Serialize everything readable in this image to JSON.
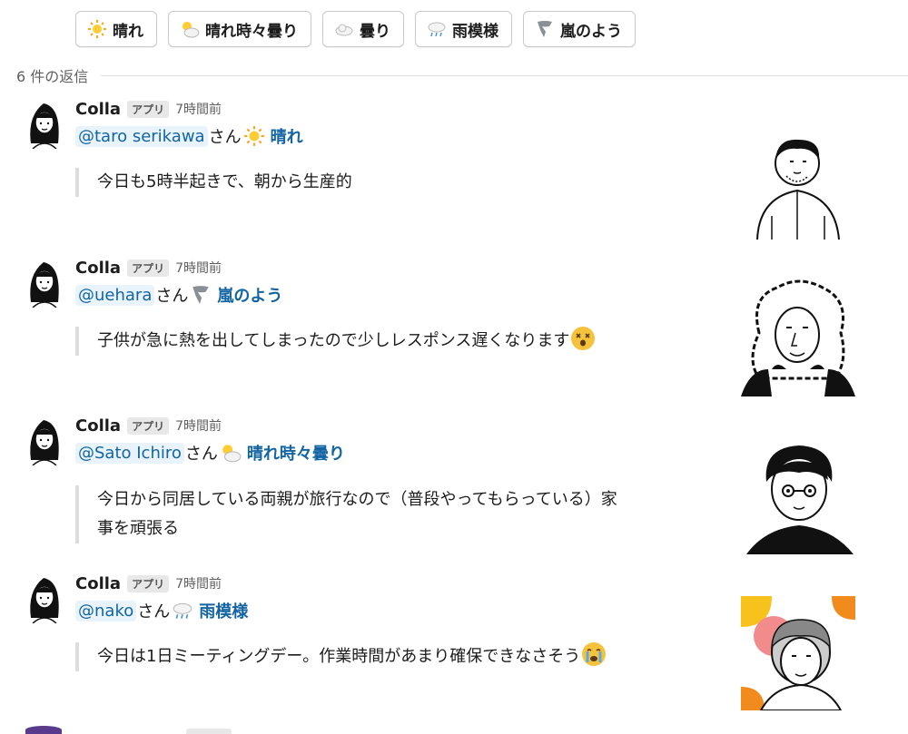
{
  "weather_buttons": [
    {
      "label": "晴れ",
      "icon": "sun-icon"
    },
    {
      "label": "晴れ時々曇り",
      "icon": "sun-behind-cloud-icon"
    },
    {
      "label": "曇り",
      "icon": "cloud-icon"
    },
    {
      "label": "雨模様",
      "icon": "rain-cloud-icon"
    },
    {
      "label": "嵐のよう",
      "icon": "tornado-icon"
    }
  ],
  "thread": {
    "reply_count_label": "6 件の返信"
  },
  "messages": [
    {
      "sender": "Colla",
      "badge": "アプリ",
      "time": "7時間前",
      "mention": "@taro serikawa",
      "suffix": "さん",
      "status_icon": "sun-icon",
      "status": "晴れ",
      "text": "今日も5時半起きで、朝から生産的",
      "emoji": ""
    },
    {
      "sender": "Colla",
      "badge": "アプリ",
      "time": "7時間前",
      "mention": "@uehara",
      "suffix": "さん",
      "status_icon": "tornado-icon",
      "status": "嵐のよう",
      "text": "子供が急に熱を出してしまったので少しレスポンス遅くなります",
      "emoji": "dizzy-face-icon"
    },
    {
      "sender": "Colla",
      "badge": "アプリ",
      "time": "7時間前",
      "mention": "@Sato Ichiro",
      "suffix": "さん",
      "status_icon": "sun-behind-cloud-icon",
      "status": "晴れ時々曇り",
      "text_line1": "今日から同居している両親が旅行なので（普段やってもらっている）家",
      "text_line2": "事を頑張る",
      "emoji": ""
    },
    {
      "sender": "Colla",
      "badge": "アプリ",
      "time": "7時間前",
      "mention": "@nako",
      "suffix": "さん",
      "status_icon": "rain-cloud-icon",
      "status": "雨模様",
      "text": "今日は1日ミーティングデー。作業時間があまり確保できなさそう",
      "emoji": "loudly-crying-face-icon"
    }
  ],
  "colors": {
    "link": "#1264a3",
    "mention_bg": "#e8f3fb",
    "accent_orange": "#f28b1e",
    "accent_yellow": "#f7c21b",
    "accent_pink": "#f28b8b"
  }
}
